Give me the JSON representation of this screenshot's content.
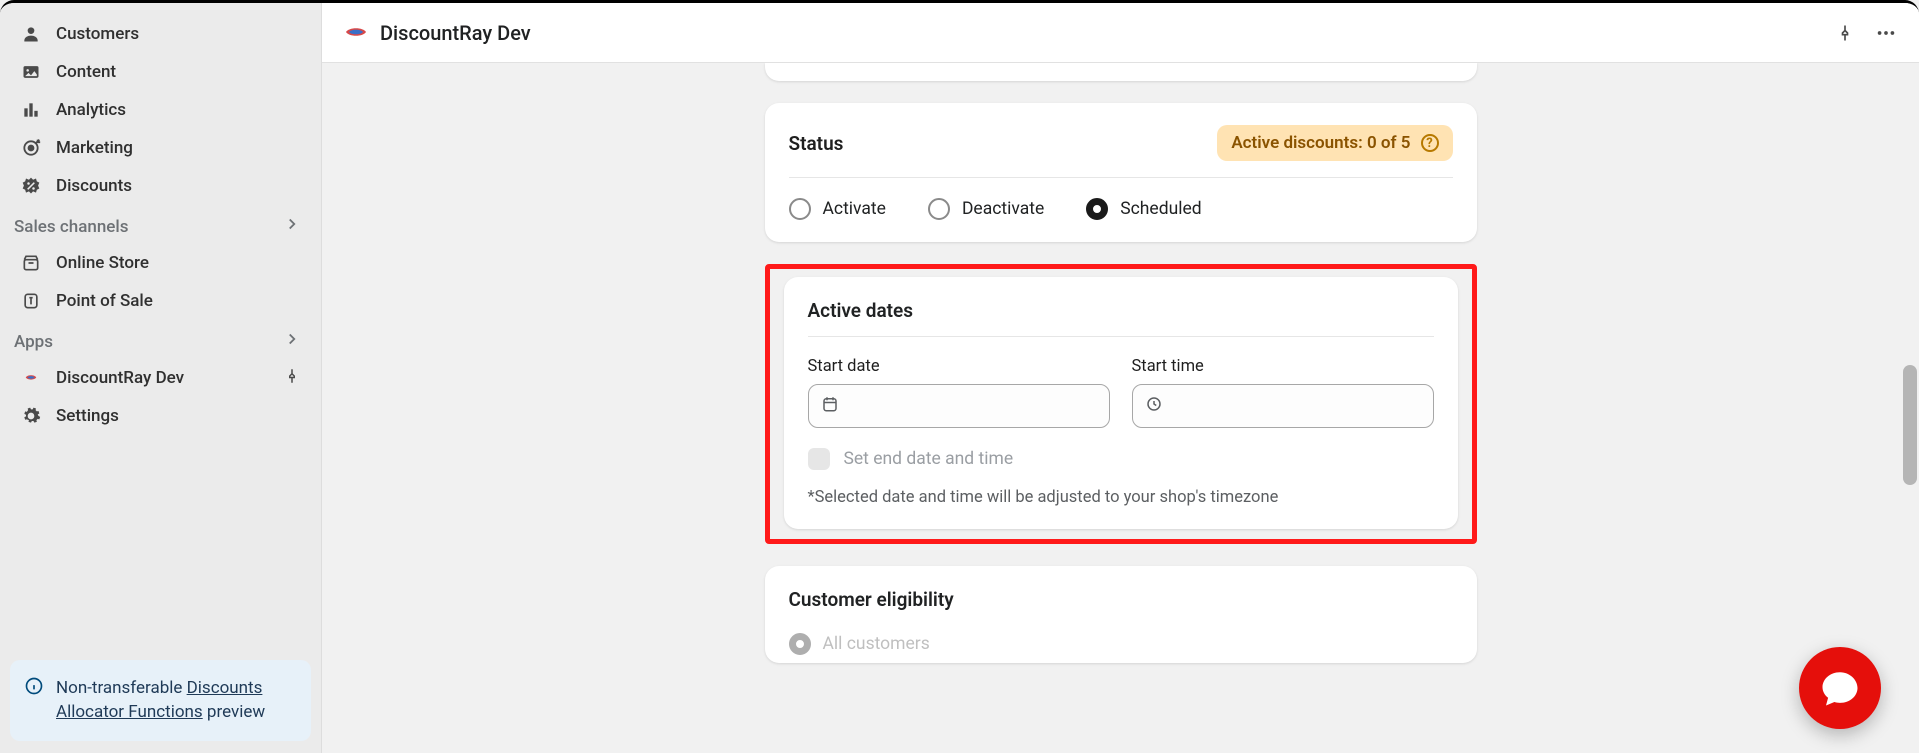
{
  "sidebar": {
    "items": [
      {
        "label": "Customers"
      },
      {
        "label": "Content"
      },
      {
        "label": "Analytics"
      },
      {
        "label": "Marketing"
      },
      {
        "label": "Discounts"
      }
    ],
    "salesChannelsLabel": "Sales channels",
    "channels": [
      {
        "label": "Online Store"
      },
      {
        "label": "Point of Sale"
      }
    ],
    "appsLabel": "Apps",
    "apps": [
      {
        "label": "DiscountRay Dev"
      }
    ],
    "settingsLabel": "Settings"
  },
  "notice": {
    "textPrefix": "Non-transferable ",
    "linkText": "Discounts Allocator Functions",
    "textSuffix": " preview"
  },
  "header": {
    "title": "DiscountRay Dev"
  },
  "statusCard": {
    "title": "Status",
    "badgeText": "Active discounts: 0 of 5",
    "options": {
      "activate": "Activate",
      "deactivate": "Deactivate",
      "scheduled": "Scheduled"
    }
  },
  "activeDates": {
    "title": "Active dates",
    "startDateLabel": "Start date",
    "startTimeLabel": "Start time",
    "endDateCheckbox": "Set end date and time",
    "hint": "*Selected date and time will be adjusted to your shop's timezone"
  },
  "eligibility": {
    "title": "Customer eligibility",
    "allCustomers": "All customers"
  }
}
